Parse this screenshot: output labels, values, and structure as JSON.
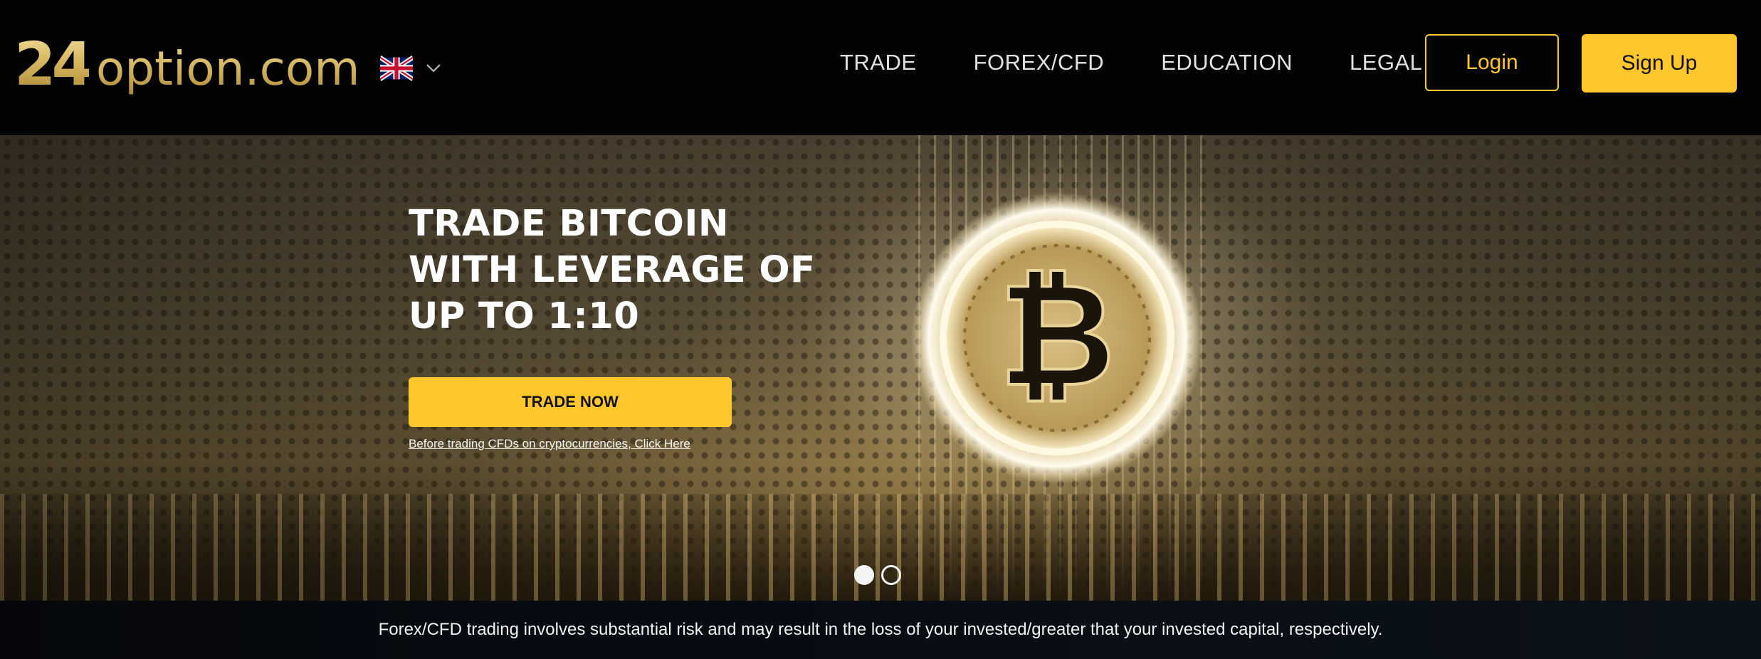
{
  "header": {
    "logo": {
      "number": "24",
      "text": "option.com"
    },
    "language": {
      "flag_icon": "uk-flag-icon",
      "chevron_icon": "chevron-down-icon"
    },
    "nav": [
      {
        "label": "TRADE"
      },
      {
        "label": "FOREX/CFD"
      },
      {
        "label": "EDUCATION"
      },
      {
        "label": "LEGAL"
      }
    ],
    "login_label": "Login",
    "signup_label": "Sign Up"
  },
  "hero": {
    "title_lines": [
      "TRADE BITCOIN",
      "WITH LEVERAGE OF",
      "UP TO 1:10"
    ],
    "cta_label": "TRADE NOW",
    "link_text": "Before trading CFDs on cryptocurrencies, Click Here",
    "image_icon": "bitcoin-coin-icon",
    "carousel": {
      "slides": 2,
      "active_index": 0
    }
  },
  "disclaimer": {
    "text": "Forex/CFD trading involves substantial risk and may result in the loss of your invested/greater that your invested capital, respectively."
  },
  "colors": {
    "accent": "#ffc72c",
    "header_bg": "#030303",
    "disclaimer_bg": "#0c121a"
  }
}
